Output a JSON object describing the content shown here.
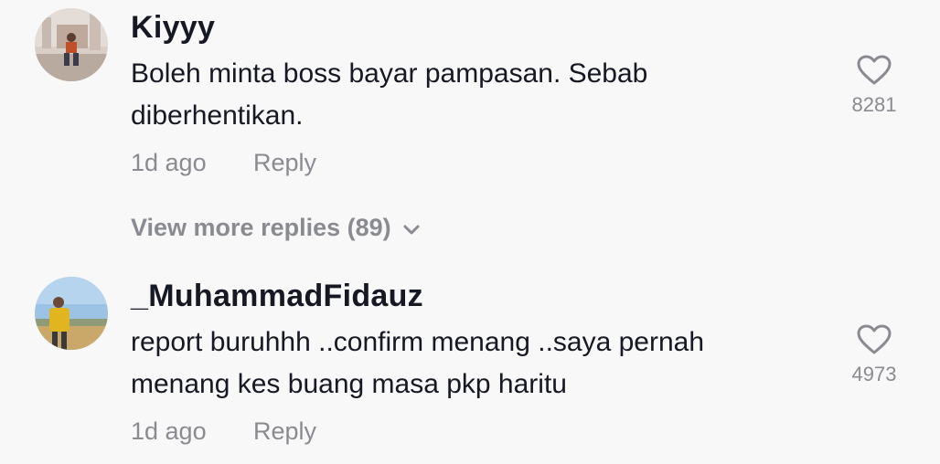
{
  "comments": [
    {
      "username": "Kiyyy",
      "text": "Boleh minta boss bayar pampasan. Sebab diberhentikan.",
      "time": "1d ago",
      "reply_label": "Reply",
      "likes": "8281",
      "avatar_icon": "user-avatar-photo"
    },
    {
      "username": "_MuhammadFidauz",
      "text": "report buruhhh ..confirm menang ..saya pernah menang kes buang masa pkp haritu",
      "time": "1d ago",
      "reply_label": "Reply",
      "likes": "4973",
      "avatar_icon": "user-avatar-photo"
    }
  ],
  "view_more": {
    "label": "View more replies (89)",
    "icon": "chevron-down-icon"
  },
  "colors": {
    "background": "#f8f8f8",
    "primary_text": "#161823",
    "secondary_text": "#8a8b91"
  }
}
